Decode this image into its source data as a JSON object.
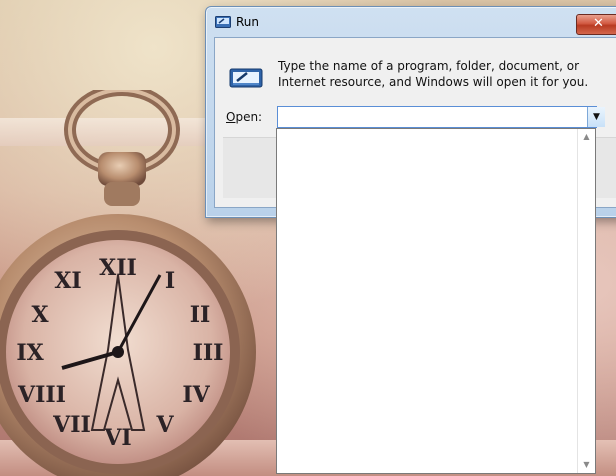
{
  "window": {
    "title": "Run",
    "close_glyph": "✕",
    "description": "Type the name of a program, folder, document, or Internet resource, and Windows will open it for you.",
    "open_label_underlined": "O",
    "open_label_rest": "pen:",
    "open_value": "",
    "dropdown_glyph": "▼"
  },
  "dropdown": {
    "items": [],
    "scroll_up_glyph": "▲",
    "scroll_down_glyph": "▼"
  },
  "icons": {
    "title": "run-icon",
    "dialog": "run-icon",
    "close": "close-icon",
    "dropdown": "chevron-down-icon"
  },
  "colors": {
    "close_button": "#c9432b",
    "input_border": "#5a8ed6",
    "title_bar": "#c4d9ee"
  }
}
